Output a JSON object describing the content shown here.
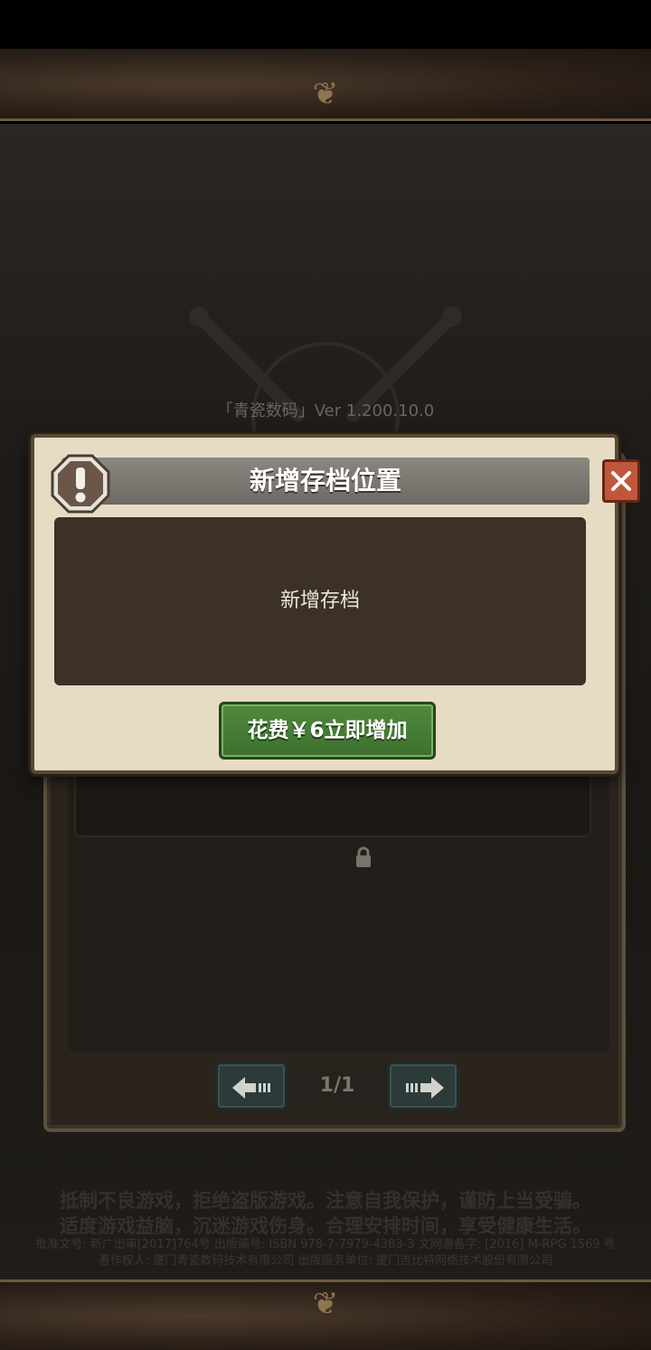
{
  "background": {
    "version": "「青瓷数码」Ver 1.200.10.0",
    "pager": {
      "page_indicator": "1/1",
      "prev_icon": "arrow-left-icon",
      "next_icon": "arrow-right-icon"
    },
    "slot_lock_icon": "lock-icon",
    "notice_line_1": "抵制不良游戏，拒绝盗版游戏。注意自我保护，谨防上当受骗。",
    "notice_line_2": "适度游戏益脑，沉迷游戏伤身。合理安排时间，享受健康生活。",
    "license_line_1": "批准文号: 新广出审[2017]764号 出版编号: ISBN 978-7-7979-4383-3 文网游备字: [2016] M-RPG 1569 号",
    "license_line_2": "著作权人: 厦门青瓷数码技术有限公司 出版服务单位: 厦门吉比特网络技术股份有限公司"
  },
  "dialog": {
    "title": "新增存档位置",
    "warning_icon": "exclamation-icon",
    "close_icon": "close-icon",
    "message": "新增存档",
    "confirm_label": "花费￥6立即增加"
  },
  "colors": {
    "dialog_paper": "#e6dcc4",
    "header_bar": "#7b7670",
    "body_panel": "#3b3128",
    "confirm_green": "#467d35",
    "close_red": "#c0573a"
  }
}
